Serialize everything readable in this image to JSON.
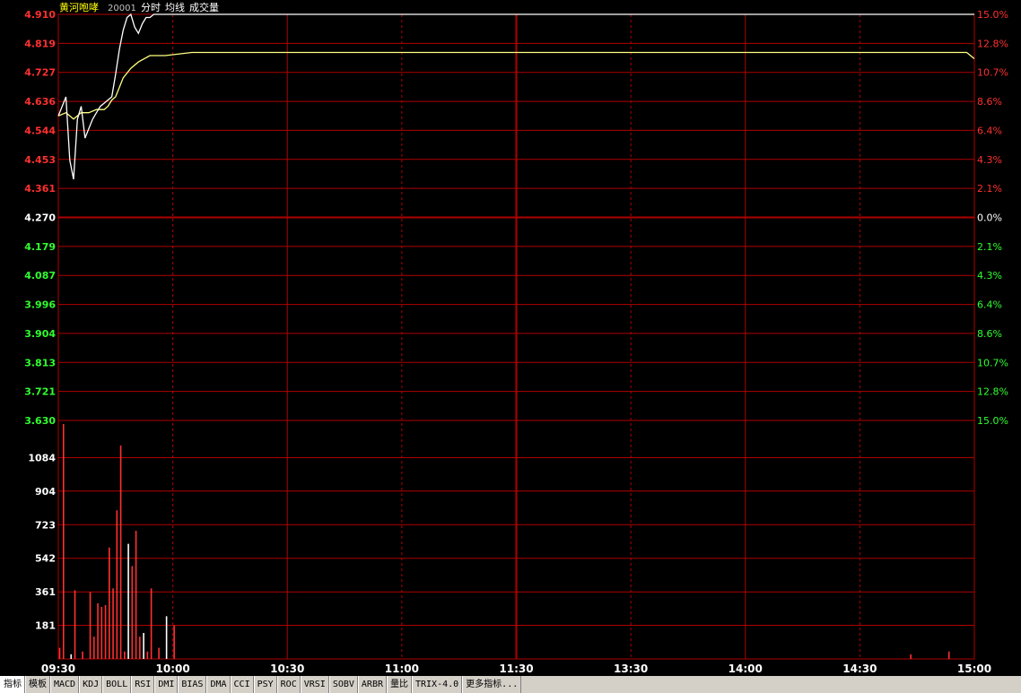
{
  "header": {
    "stock_name": "黄河咆哮",
    "code": "20001",
    "mode_labels": [
      "分时",
      "均线",
      "成交量"
    ]
  },
  "price_axis": {
    "left_labels": [
      "4.910",
      "4.819",
      "4.727",
      "4.636",
      "4.544",
      "4.453",
      "4.361",
      "4.270",
      "4.179",
      "4.087",
      "3.996",
      "3.904",
      "3.813",
      "3.721",
      "3.630"
    ],
    "right_labels": [
      "15.0%",
      "12.8%",
      "10.7%",
      "8.6%",
      "6.4%",
      "4.3%",
      "2.1%",
      "0.0%",
      "2.1%",
      "4.3%",
      "6.4%",
      "8.6%",
      "10.7%",
      "12.8%",
      "15.0%"
    ],
    "prev_close": 4.27,
    "ylim": [
      3.63,
      4.91
    ]
  },
  "volume_axis": {
    "labels": [
      "1084",
      "904",
      "723",
      "542",
      "361",
      "181"
    ],
    "ylim": [
      0,
      1265
    ]
  },
  "time_axis": {
    "labels": [
      "09:30",
      "10:00",
      "10:30",
      "11:00",
      "11:30",
      "13:30",
      "14:00",
      "14:30",
      "15:00"
    ]
  },
  "colors": {
    "up": "#ff3030",
    "down": "#30ff30",
    "neutral": "#ffffff",
    "grid": "#b00000",
    "price_line": "#ffffff",
    "avg_line": "#ffff80",
    "header": "#ffff00",
    "code": "#c0c0c0"
  },
  "chart_data": {
    "type": "line",
    "series": [
      {
        "values": [
          [
            0,
            4.59
          ],
          [
            1,
            4.62
          ],
          [
            2,
            4.65
          ],
          [
            3,
            4.45
          ],
          [
            4,
            4.39
          ],
          [
            5,
            4.58
          ],
          [
            6,
            4.62
          ],
          [
            7,
            4.52
          ],
          [
            8,
            4.55
          ],
          [
            9,
            4.58
          ],
          [
            10,
            4.6
          ],
          [
            11,
            4.62
          ],
          [
            12,
            4.63
          ],
          [
            13,
            4.64
          ],
          [
            14,
            4.65
          ],
          [
            15,
            4.72
          ],
          [
            16,
            4.8
          ],
          [
            17,
            4.86
          ],
          [
            18,
            4.9
          ],
          [
            19,
            4.91
          ],
          [
            20,
            4.87
          ],
          [
            21,
            4.85
          ],
          [
            22,
            4.88
          ],
          [
            23,
            4.9
          ],
          [
            24,
            4.9
          ],
          [
            25,
            4.91
          ],
          [
            26,
            4.91
          ],
          [
            27,
            4.91
          ],
          [
            30,
            4.91
          ],
          [
            60,
            4.91
          ],
          [
            90,
            4.91
          ],
          [
            120,
            4.91
          ],
          [
            150,
            4.91
          ],
          [
            180,
            4.91
          ],
          [
            210,
            4.91
          ],
          [
            240,
            4.91
          ]
        ]
      },
      {
        "values": [
          [
            0,
            4.59
          ],
          [
            2,
            4.6
          ],
          [
            4,
            4.58
          ],
          [
            6,
            4.6
          ],
          [
            8,
            4.6
          ],
          [
            10,
            4.61
          ],
          [
            12,
            4.61
          ],
          [
            13,
            4.62
          ],
          [
            14,
            4.64
          ],
          [
            15,
            4.65
          ],
          [
            16,
            4.68
          ],
          [
            17,
            4.71
          ],
          [
            19,
            4.74
          ],
          [
            21,
            4.76
          ],
          [
            24,
            4.78
          ],
          [
            28,
            4.78
          ],
          [
            35,
            4.79
          ],
          [
            60,
            4.79
          ],
          [
            120,
            4.79
          ],
          [
            180,
            4.79
          ],
          [
            238,
            4.79
          ],
          [
            240,
            4.77
          ]
        ]
      }
    ],
    "volume": [
      [
        0,
        60,
        "up"
      ],
      [
        1,
        1265,
        "up"
      ],
      [
        3,
        25,
        "neutral"
      ],
      [
        4,
        370,
        "up"
      ],
      [
        6,
        40,
        "up"
      ],
      [
        8,
        360,
        "up"
      ],
      [
        9,
        120,
        "up"
      ],
      [
        10,
        300,
        "up"
      ],
      [
        11,
        280,
        "up"
      ],
      [
        12,
        290,
        "up"
      ],
      [
        13,
        600,
        "up"
      ],
      [
        14,
        380,
        "up"
      ],
      [
        15,
        800,
        "up"
      ],
      [
        16,
        1150,
        "up"
      ],
      [
        17,
        40,
        "up"
      ],
      [
        18,
        620,
        "neutral"
      ],
      [
        19,
        500,
        "up"
      ],
      [
        20,
        690,
        "up"
      ],
      [
        21,
        120,
        "up"
      ],
      [
        22,
        140,
        "neutral"
      ],
      [
        23,
        40,
        "up"
      ],
      [
        24,
        380,
        "up"
      ],
      [
        26,
        60,
        "up"
      ],
      [
        28,
        230,
        "neutral"
      ],
      [
        30,
        180,
        "up"
      ],
      [
        223,
        25,
        "up"
      ],
      [
        233,
        40,
        "up"
      ]
    ]
  },
  "toolbar": {
    "buttons": [
      "指标",
      "模板",
      "MACD",
      "KDJ",
      "BOLL",
      "RSI",
      "DMI",
      "BIAS",
      "DMA",
      "CCI",
      "PSY",
      "ROC",
      "VRSI",
      "SOBV",
      "ARBR",
      "量比",
      "TRIX-4.0",
      "更多指标..."
    ]
  }
}
